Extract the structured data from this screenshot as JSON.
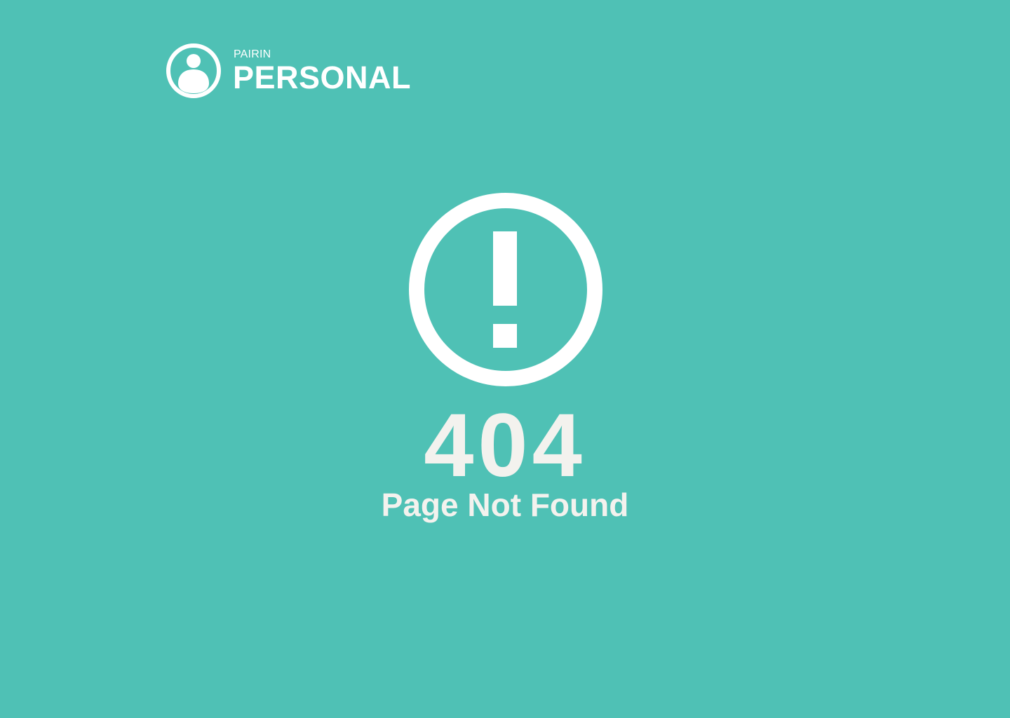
{
  "colors": {
    "background": "#4fc1b5",
    "foreground": "#ffffff",
    "text_light": "#f3f2ee"
  },
  "brand": {
    "icon": "user-circle-icon",
    "subtitle": "PAIRIN",
    "title": "PERSONAL"
  },
  "error": {
    "icon": "exclamation-circle-icon",
    "code": "404",
    "message": "Page Not Found"
  }
}
